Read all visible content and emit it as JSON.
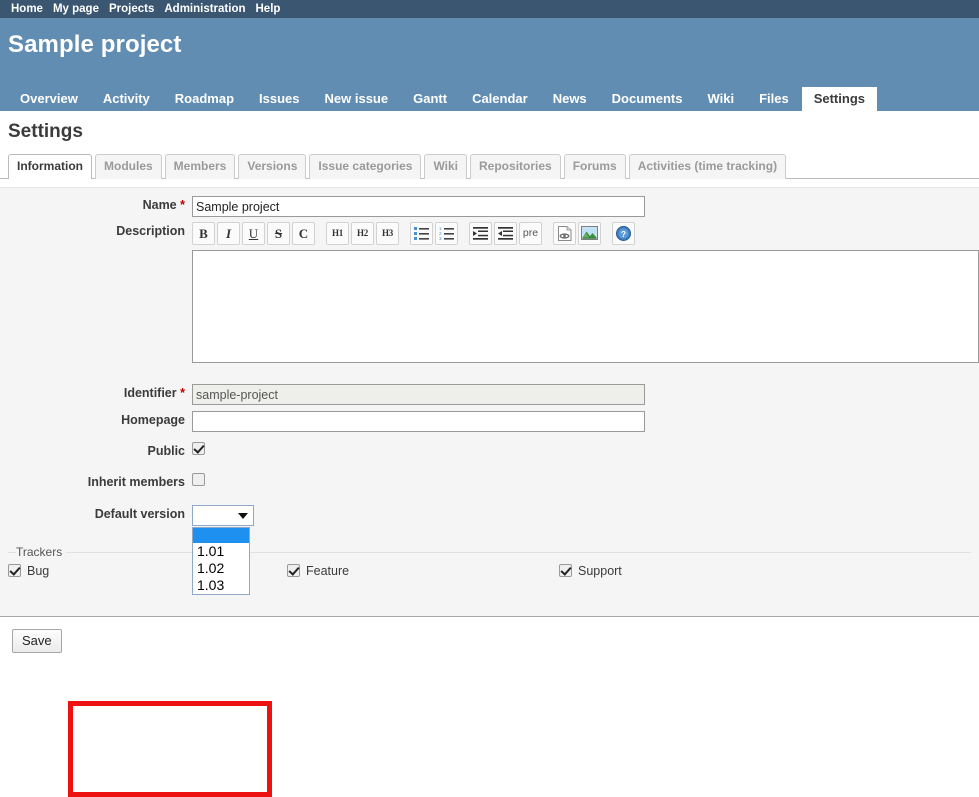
{
  "top_menu": {
    "items": [
      {
        "label": "Home",
        "name": "top-menu-home"
      },
      {
        "label": "My page",
        "name": "top-menu-my-page"
      },
      {
        "label": "Projects",
        "name": "top-menu-projects"
      },
      {
        "label": "Administration",
        "name": "top-menu-administration"
      },
      {
        "label": "Help",
        "name": "top-menu-help"
      }
    ]
  },
  "header": {
    "project_title": "Sample project"
  },
  "main_menu": {
    "items": [
      {
        "label": "Overview",
        "selected": false
      },
      {
        "label": "Activity",
        "selected": false
      },
      {
        "label": "Roadmap",
        "selected": false
      },
      {
        "label": "Issues",
        "selected": false
      },
      {
        "label": "New issue",
        "selected": false
      },
      {
        "label": "Gantt",
        "selected": false
      },
      {
        "label": "Calendar",
        "selected": false
      },
      {
        "label": "News",
        "selected": false
      },
      {
        "label": "Documents",
        "selected": false
      },
      {
        "label": "Wiki",
        "selected": false
      },
      {
        "label": "Files",
        "selected": false
      },
      {
        "label": "Settings",
        "selected": true
      }
    ]
  },
  "content": {
    "page_title": "Settings"
  },
  "tabs": {
    "items": [
      {
        "label": "Information",
        "selected": true
      },
      {
        "label": "Modules",
        "selected": false
      },
      {
        "label": "Members",
        "selected": false
      },
      {
        "label": "Versions",
        "selected": false
      },
      {
        "label": "Issue categories",
        "selected": false
      },
      {
        "label": "Wiki",
        "selected": false
      },
      {
        "label": "Repositories",
        "selected": false
      },
      {
        "label": "Forums",
        "selected": false
      },
      {
        "label": "Activities (time tracking)",
        "selected": false
      }
    ]
  },
  "form": {
    "name": {
      "label": "Name",
      "required_marker": "*",
      "value": "Sample project"
    },
    "description": {
      "label": "Description",
      "value": ""
    },
    "identifier": {
      "label": "Identifier",
      "required_marker": "*",
      "value": "sample-project"
    },
    "homepage": {
      "label": "Homepage",
      "value": ""
    },
    "public": {
      "label": "Public",
      "checked": true
    },
    "inherit_members": {
      "label": "Inherit members",
      "checked": false
    },
    "default_version": {
      "label": "Default version",
      "selected_value": "",
      "expanded": true,
      "options": [
        "",
        "1.01",
        "1.02",
        "1.03"
      ]
    }
  },
  "toolbar": {
    "buttons": [
      {
        "icon": "bold-icon",
        "glyph": "B",
        "style": "b"
      },
      {
        "icon": "italic-icon",
        "glyph": "I",
        "style": "i"
      },
      {
        "icon": "underline-icon",
        "glyph": "U",
        "style": "u"
      },
      {
        "icon": "strikethrough-icon",
        "glyph": "S",
        "style": "s"
      },
      {
        "icon": "code-icon",
        "glyph": "C",
        "style": "c"
      },
      {
        "icon": "heading-1-icon",
        "glyph": "H1",
        "style": "h",
        "gap_before": true
      },
      {
        "icon": "heading-2-icon",
        "glyph": "H2",
        "style": "h"
      },
      {
        "icon": "heading-3-icon",
        "glyph": "H3",
        "style": "h"
      },
      {
        "icon": "unordered-list-icon",
        "glyph": "",
        "style": "svg-ul",
        "gap_before": true
      },
      {
        "icon": "ordered-list-icon",
        "glyph": "",
        "style": "svg-ol"
      },
      {
        "icon": "indent-icon",
        "glyph": "",
        "style": "svg-indent",
        "gap_before": true
      },
      {
        "icon": "outdent-icon",
        "glyph": "",
        "style": "svg-outdent"
      },
      {
        "icon": "preformatted-icon",
        "glyph": "pre",
        "style": "pre"
      },
      {
        "icon": "insert-link-icon",
        "glyph": "",
        "style": "svg-link",
        "gap_before": true
      },
      {
        "icon": "insert-image-icon",
        "glyph": "",
        "style": "svg-image"
      },
      {
        "icon": "help-icon",
        "glyph": "",
        "style": "svg-help",
        "gap_before": true
      }
    ]
  },
  "trackers": {
    "legend": "Trackers",
    "items": [
      {
        "label": "Bug",
        "checked": true
      },
      {
        "label": "Feature",
        "checked": true
      },
      {
        "label": "Support",
        "checked": true
      }
    ]
  },
  "actions": {
    "save_label": "Save"
  },
  "colors": {
    "top_bar": "#3a5670",
    "header": "#628db3",
    "box_bg": "#f5f5f5",
    "highlight": "#ee1111",
    "select_highlight": "#1e90ef",
    "required": "#bb0000"
  }
}
